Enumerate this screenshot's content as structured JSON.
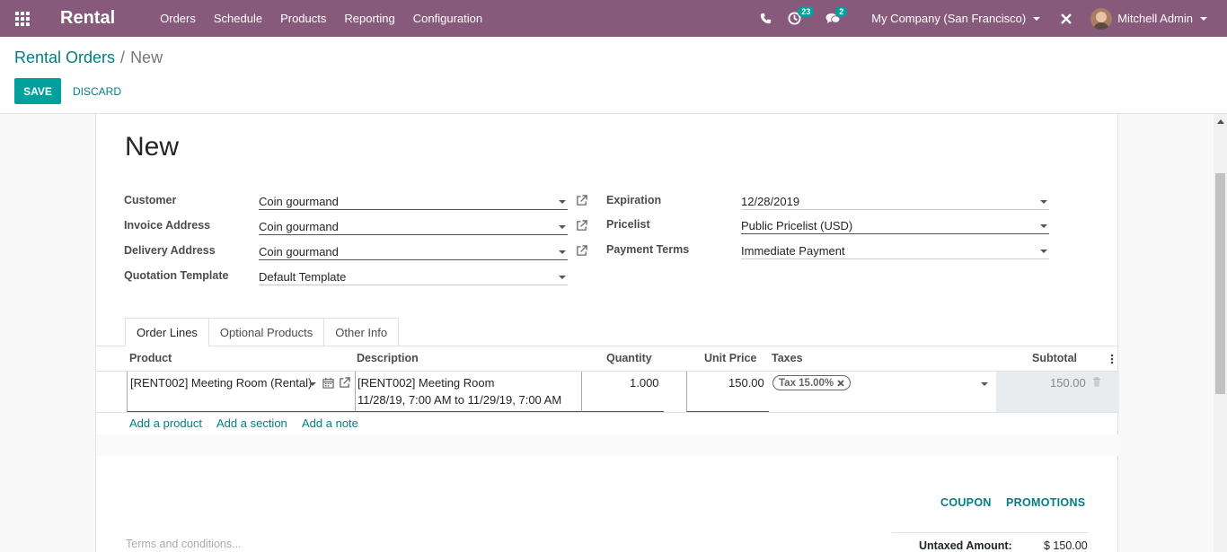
{
  "navbar": {
    "brand": "Rental",
    "menu": [
      "Orders",
      "Schedule",
      "Products",
      "Reporting",
      "Configuration"
    ],
    "activities_count": "23",
    "messages_count": "2",
    "company": "My Company (San Francisco)",
    "user": "Mitchell Admin",
    "bg_color": "#875a7b"
  },
  "breadcrumb": {
    "parent": "Rental Orders",
    "separator": "/",
    "current": "New"
  },
  "buttons": {
    "save": "SAVE",
    "discard": "DISCARD"
  },
  "form": {
    "title": "New",
    "left_fields": [
      {
        "label": "Customer",
        "value": "Coin gourmand"
      },
      {
        "label": "Invoice Address",
        "value": "Coin gourmand"
      },
      {
        "label": "Delivery Address",
        "value": "Coin gourmand"
      },
      {
        "label": "Quotation Template",
        "value": "Default Template"
      }
    ],
    "right_fields": [
      {
        "label": "Expiration",
        "value": "12/28/2019"
      },
      {
        "label": "Pricelist",
        "value": "Public Pricelist (USD)"
      },
      {
        "label": "Payment Terms",
        "value": "Immediate Payment"
      }
    ]
  },
  "tabs": [
    "Order Lines",
    "Optional Products",
    "Other Info"
  ],
  "table": {
    "headers": {
      "product": "Product",
      "description": "Description",
      "quantity": "Quantity",
      "unit_price": "Unit Price",
      "taxes": "Taxes",
      "subtotal": "Subtotal"
    },
    "row": {
      "product": "[RENT002] Meeting Room (Rental)",
      "description_line1": "[RENT002] Meeting Room",
      "description_line2": "11/28/19, 7:00 AM to 11/29/19, 7:00 AM",
      "quantity": "1.000",
      "unit_price": "150.00",
      "tax": "Tax 15.00%",
      "subtotal": "150.00"
    },
    "add_links": [
      "Add a product",
      "Add a section",
      "Add a note"
    ]
  },
  "footer": {
    "coupon": "COUPON",
    "promotions": "PROMOTIONS",
    "terms_placeholder": "Terms and conditions...",
    "untaxed_label": "Untaxed Amount:",
    "untaxed_value": "$ 150.00"
  },
  "colors": {
    "accent": "#00a09d",
    "link": "#017e84"
  }
}
